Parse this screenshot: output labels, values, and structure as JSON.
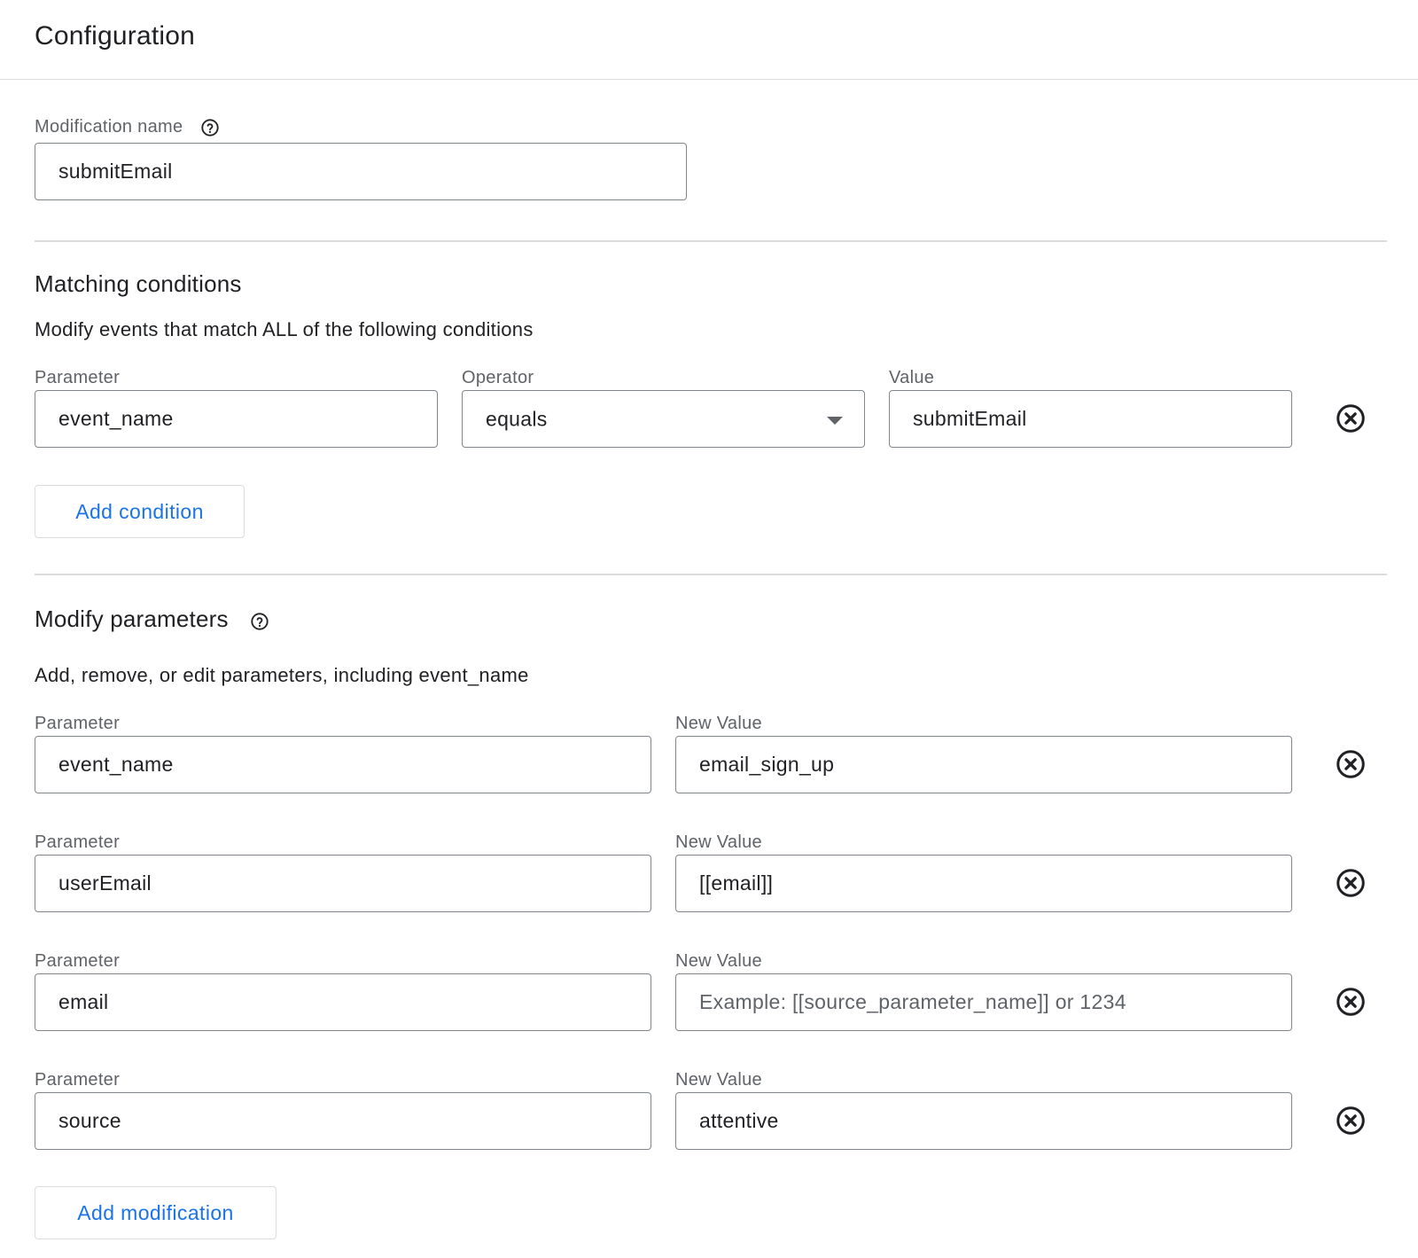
{
  "header": {
    "title": "Configuration"
  },
  "modification_name": {
    "label": "Modification name",
    "value": "submitEmail",
    "help_icon": "help-circle-icon"
  },
  "matching_conditions": {
    "title": "Matching conditions",
    "description": "Modify events that match ALL of the following conditions",
    "condition": {
      "parameter_label": "Parameter",
      "parameter_value": "event_name",
      "operator_label": "Operator",
      "operator_value": "equals",
      "value_label": "Value",
      "value_value": "submitEmail",
      "remove_icon": "close-circle-icon"
    },
    "add_button_label": "Add condition"
  },
  "modify_parameters": {
    "title": "Modify parameters",
    "help_icon": "help-circle-icon",
    "description": "Add, remove, or edit parameters, including event_name",
    "rows": [
      {
        "parameter_label": "Parameter",
        "parameter_value": "event_name",
        "new_value_label": "New Value",
        "new_value_value": "email_sign_up",
        "new_value_placeholder": ""
      },
      {
        "parameter_label": "Parameter",
        "parameter_value": "userEmail",
        "new_value_label": "New Value",
        "new_value_value": "[[email]]",
        "new_value_placeholder": ""
      },
      {
        "parameter_label": "Parameter",
        "parameter_value": "email",
        "new_value_label": "New Value",
        "new_value_value": "",
        "new_value_placeholder": "Example: [[source_parameter_name]] or 1234"
      },
      {
        "parameter_label": "Parameter",
        "parameter_value": "source",
        "new_value_label": "New Value",
        "new_value_value": "attentive",
        "new_value_placeholder": ""
      }
    ],
    "remove_icon": "close-circle-icon",
    "add_button_label": "Add modification"
  },
  "colors": {
    "accent": "#1a73e8",
    "text_primary": "#202124",
    "text_secondary": "#5f6368",
    "border": "#80868b",
    "divider": "#dadce0"
  }
}
